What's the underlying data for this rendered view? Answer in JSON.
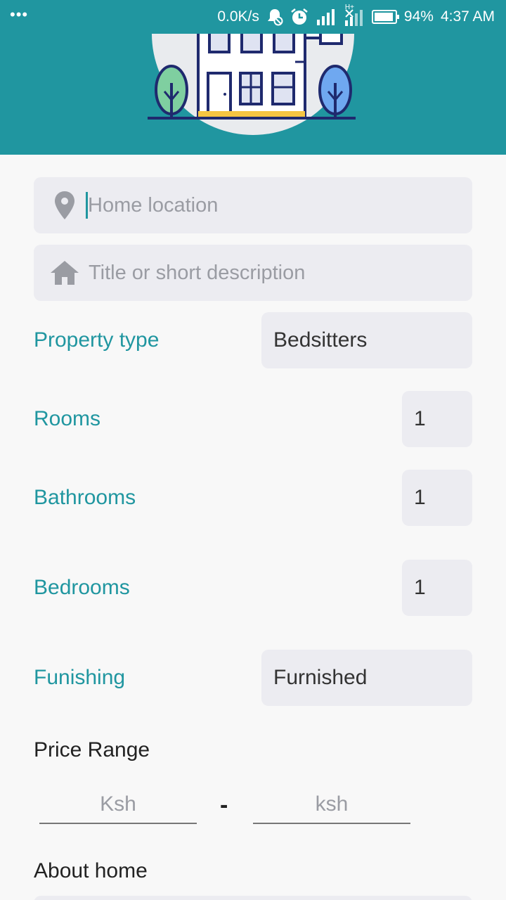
{
  "status_bar": {
    "menu_dots": "•••",
    "network_speed": "0.0K/s",
    "network_type": "H+",
    "battery": "94%",
    "battery_level": 0.94,
    "time": "4:37 AM",
    "icons": [
      "notification-muted-icon",
      "alarm-icon",
      "signal-icon",
      "signal-icon",
      "battery-icon"
    ]
  },
  "form": {
    "location_placeholder": "Home location",
    "title_placeholder": "Title or short description",
    "property_type": {
      "label": "Property type",
      "value": "Bedsitters"
    },
    "rooms": {
      "label": "Rooms",
      "value": "1"
    },
    "bathrooms": {
      "label": "Bathrooms",
      "value": "1"
    },
    "bedrooms": {
      "label": "Bedrooms",
      "value": "1"
    },
    "furnishing": {
      "label": "Funishing",
      "value": "Furnished"
    },
    "price_range": {
      "label": "Price Range",
      "min_placeholder": "Ksh",
      "separator": "-",
      "max_placeholder": "ksh"
    },
    "about_label": "About home"
  },
  "colors": {
    "accent": "#2096a0",
    "field_bg": "#ececf1",
    "page_bg": "#f8f8f8"
  }
}
